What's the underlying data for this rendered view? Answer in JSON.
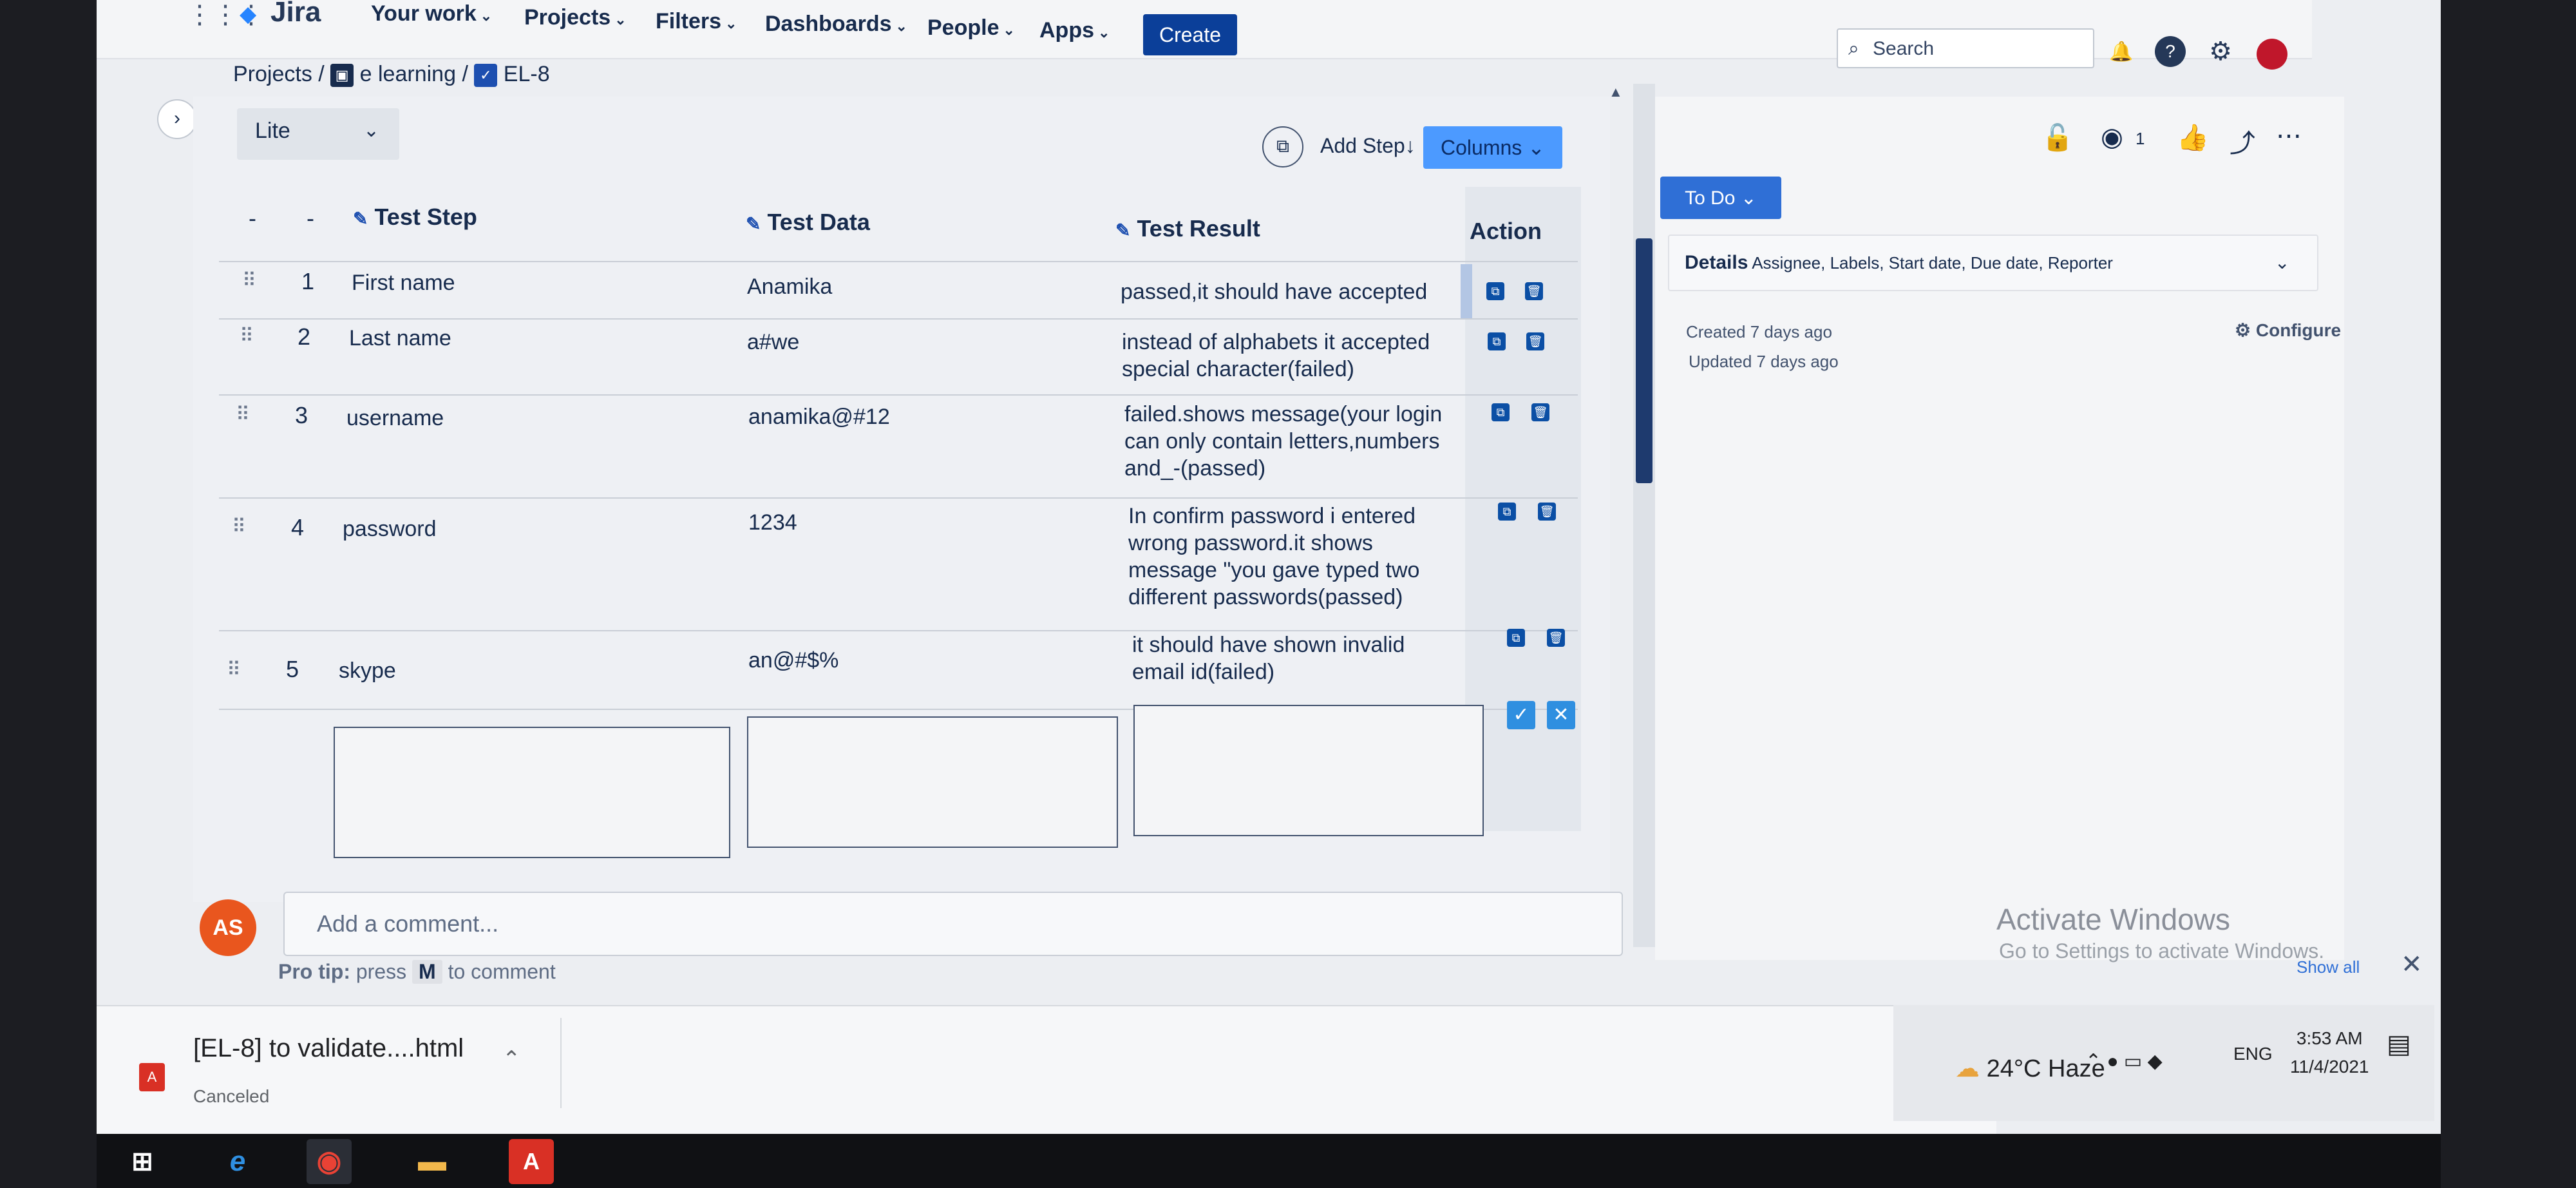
{
  "topnav": {
    "logo": "Jira",
    "items": [
      "Your work",
      "Projects",
      "Filters",
      "Dashboards",
      "People",
      "Apps"
    ],
    "create_label": "Create",
    "search_placeholder": "Search"
  },
  "breadcrumb": {
    "root": "Projects",
    "project": "e learning",
    "issue": "EL-8"
  },
  "test_steps": {
    "view_select": "Lite",
    "add_step_label": "Add Step↓",
    "columns_label": "Columns",
    "headers": {
      "step": "Test Step",
      "data": "Test Data",
      "result": "Test Result",
      "action": "Action"
    },
    "header_dashes": [
      "-",
      "-"
    ],
    "rows": [
      {
        "num": "1",
        "step": "First name",
        "data": "Anamika",
        "result": "passed,it should have accepted"
      },
      {
        "num": "2",
        "step": "Last name",
        "data": "a#we",
        "result": "instead of alphabets it accepted special character(failed)"
      },
      {
        "num": "3",
        "step": "username",
        "data": "anamika@#12",
        "result": "failed.shows message(your login can only contain letters,numbers and_-(passed)"
      },
      {
        "num": "4",
        "step": "password",
        "data": "1234",
        "result": "In confirm password i entered wrong password.it shows message \"you gave typed two different passwords(passed)"
      },
      {
        "num": "5",
        "step": "skype",
        "data": "an@#$%",
        "result": "it should have shown invalid email id(failed)"
      }
    ]
  },
  "comment": {
    "avatar_initials": "AS",
    "placeholder": "Add a comment...",
    "protip_label": "Pro tip:",
    "protip_press": "press",
    "protip_key": "M",
    "protip_suffix": "to comment"
  },
  "sidebar": {
    "status": "To Do",
    "details_title": "Details",
    "details_fields": "Assignee, Labels, Start date, Due date, Reporter",
    "created": "Created 7 days ago",
    "updated": "Updated 7 days ago",
    "configure": "Configure",
    "watch_count": "1"
  },
  "windows": {
    "activate_title": "Activate Windows",
    "activate_sub": "Go to Settings to activate Windows.",
    "show_all": "Show all"
  },
  "download": {
    "filename": "[EL-8] to validate....html",
    "status": "Canceled"
  },
  "tray": {
    "weather": "24°C  Haze",
    "lang": "ENG",
    "time": "3:53 AM",
    "date": "11/4/2021"
  }
}
